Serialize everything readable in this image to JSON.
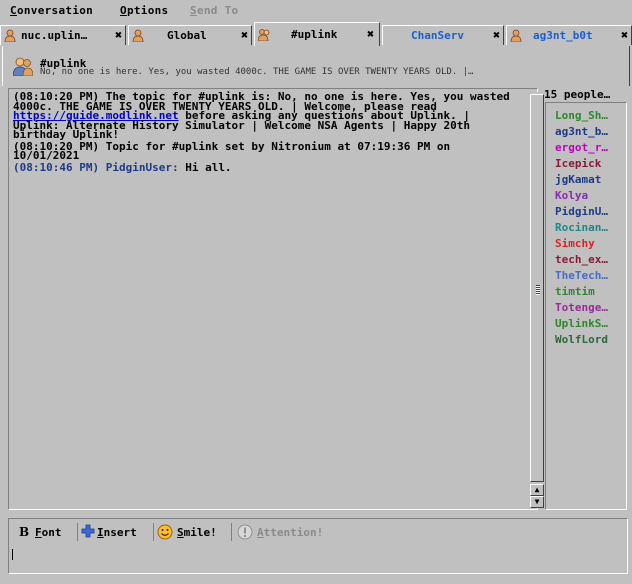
{
  "menu": {
    "items": [
      {
        "label_u": "C",
        "label_rest": "onversation"
      },
      {
        "label_u": "O",
        "label_rest": "ptions"
      },
      {
        "label_u": "S",
        "label_rest": "end To"
      }
    ]
  },
  "tabs": [
    {
      "label": "nuc.uplin…",
      "close": "✖"
    },
    {
      "label": "Global",
      "close": "✖"
    },
    {
      "label": "#uplink",
      "close": "✖"
    },
    {
      "label": "ChanServ",
      "close": "✖"
    },
    {
      "label": "ag3nt_b0t",
      "close": "✖"
    }
  ],
  "header": {
    "channel": "#uplink",
    "topic": "No, no one is here. Yes, you wasted 4000c. THE GAME IS OVER TWENTY YEARS OLD. |…"
  },
  "chat": {
    "messages": [
      {
        "time": "(08:10:20 PM)",
        "text_before": " The topic for #uplink is: No, no one is here. Yes, you wasted 4000c. THE GAME IS OVER TWENTY YEARS OLD. | Welcome, please read ",
        "link": "https://guide.modlink.net",
        "text_after": " before asking any questions about Uplink. | Uplink: Alternate History Simulator | Welcome NSA Agents | Happy 20th birthday Uplink!"
      },
      {
        "time": "(08:10:20 PM)",
        "text_before": " Topic for #uplink set by Nitronium at 07:19:36 PM on 10/01/2021"
      },
      {
        "time": "(08:10:46 PM)",
        "user": " PidginUser:",
        "text_before": " Hi all."
      }
    ]
  },
  "userlist": {
    "count": "15 people…",
    "users": [
      {
        "name": "Long_Sh…",
        "color": "#2a8a2a"
      },
      {
        "name": "ag3nt_b…",
        "color": "#1d3a8a"
      },
      {
        "name": "ergot_r…",
        "color": "#c000c0"
      },
      {
        "name": "Icepick",
        "color": "#8b1a3a"
      },
      {
        "name": "jgKamat",
        "color": "#1d3a8a"
      },
      {
        "name": "Kolya",
        "color": "#8a2ab0"
      },
      {
        "name": "PidginU…",
        "color": "#1d3a8a"
      },
      {
        "name": "Rocinan…",
        "color": "#1a8a8a"
      },
      {
        "name": "Simchy",
        "color": "#e02020"
      },
      {
        "name": "tech_ex…",
        "color": "#8b1a3a"
      },
      {
        "name": "TheTech…",
        "color": "#4a6ad0"
      },
      {
        "name": "timtim",
        "color": "#2a8a2a"
      },
      {
        "name": "Totenge…",
        "color": "#9a2a9a"
      },
      {
        "name": "UplinkS…",
        "color": "#2a8a2a"
      },
      {
        "name": "WolfLord",
        "color": "#2a6a3a"
      }
    ]
  },
  "toolbar": {
    "font_label_u": "F",
    "font_label_rest": "ont",
    "insert_label_u": "I",
    "insert_label_rest": "nsert",
    "smile_label_u": "S",
    "smile_label_rest": "mile!",
    "attention_label_u": "A",
    "attention_label_rest": "ttention!"
  }
}
